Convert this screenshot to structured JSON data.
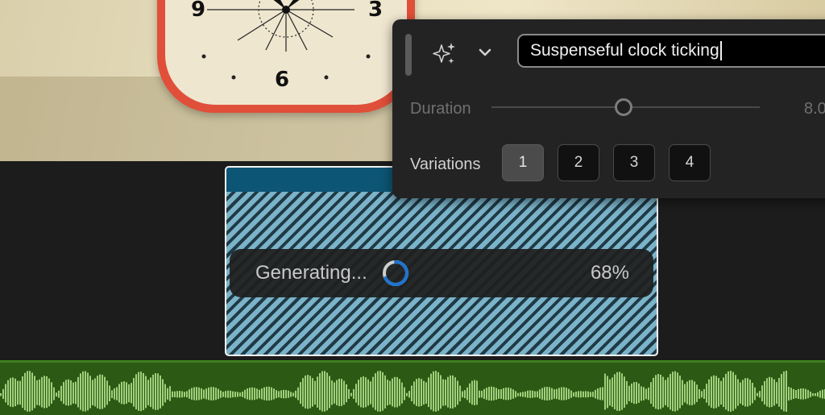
{
  "video": {
    "clock_numerals": [
      "9",
      "3",
      "6"
    ]
  },
  "generation_panel": {
    "prompt_value": "Suspenseful clock ticking",
    "duration": {
      "label": "Duration",
      "value_text": "8.0",
      "slider_fraction": 0.5
    },
    "variations": {
      "label": "Variations",
      "options": [
        "1",
        "2",
        "3",
        "4"
      ],
      "selected": "1"
    },
    "icons": [
      "drag-handle-icon",
      "sparkle-icon",
      "chevron-down-icon"
    ]
  },
  "timeline": {
    "generating_clip": {
      "status_label": "Generating...",
      "progress_text": "68%",
      "progress": 0.68,
      "accent_color": "#1e74d2"
    },
    "audio_track_color": "#2c5a14"
  }
}
